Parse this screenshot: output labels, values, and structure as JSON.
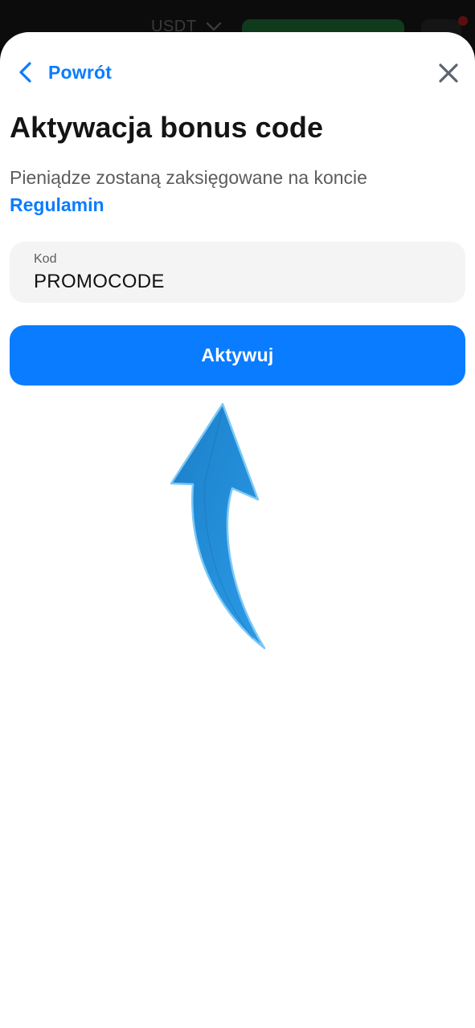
{
  "background_app": {
    "currency": "USDT"
  },
  "header": {
    "back_label": "Powrót"
  },
  "page": {
    "title": "Aktywacja bonus code",
    "subtitle": "Pieniądze zostaną zaksięgowane na koncie",
    "terms_link": "Regulamin"
  },
  "code_input": {
    "label": "Kod",
    "value": "PROMOCODE"
  },
  "activate_button": {
    "label": "Aktywuj"
  },
  "colors": {
    "accent": "#0a7cff",
    "arrow": "#2a8fd8"
  },
  "icons": {
    "back": "chevron-left-icon",
    "close": "close-icon",
    "pointer": "curved-arrow-up-icon"
  }
}
